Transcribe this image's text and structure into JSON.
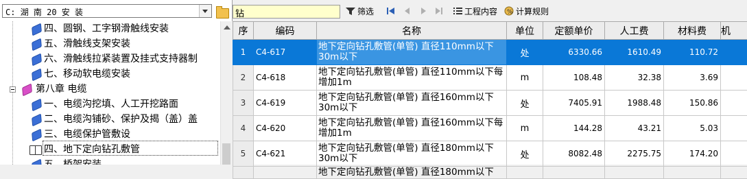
{
  "left_panel": {
    "combo_value": "C: 湖 南 20 安 装",
    "tree": [
      {
        "label": "四、圆钢、工字钢滑触线安装",
        "icon": "blue-book-icon"
      },
      {
        "label": "五、滑触线支架安装",
        "icon": "blue-book-icon"
      },
      {
        "label": "六、滑触线拉紧装置及挂式支持器制",
        "icon": "blue-book-icon"
      },
      {
        "label": "七、移动软电缆安装",
        "icon": "blue-book-icon"
      },
      {
        "label": "第八章 电缆",
        "icon": "pink-book-icon"
      },
      {
        "label": "一、电缆沟挖填、人工开挖路面",
        "icon": "blue-book-icon"
      },
      {
        "label": "二、电缆沟铺砂、保护及揭（盖）盖",
        "icon": "blue-book-icon"
      },
      {
        "label": "三、电缆保护管敷设",
        "icon": "blue-book-icon"
      },
      {
        "label": "四、地下定向钻孔敷管",
        "icon": "open-book-icon"
      },
      {
        "label": "五、桥架安装",
        "icon": "blue-book-icon"
      }
    ]
  },
  "toolbar": {
    "search_value": "钻",
    "filter_label": "筛选",
    "work_content_label": "工程内容",
    "calc_rule_label": "计算规则"
  },
  "grid": {
    "headers": [
      "序",
      "编码",
      "名称",
      "单位",
      "定额单价",
      "人工费",
      "材料费",
      "机"
    ],
    "rows": [
      {
        "n": "1",
        "code": "C4-617",
        "name": "地下定向钻孔敷管(单管) 直径110mm以下30m以下",
        "unit": "处",
        "price": "6330.66",
        "labor": "1610.49",
        "material": "110.72"
      },
      {
        "n": "2",
        "code": "C4-618",
        "name": "地下定向钻孔敷管(单管) 直径110mm以下每增加1m",
        "unit": "m",
        "price": "108.48",
        "labor": "32.38",
        "material": "3.69"
      },
      {
        "n": "3",
        "code": "C4-619",
        "name": "地下定向钻孔敷管(单管) 直径160mm以下30m以下",
        "unit": "处",
        "price": "7405.91",
        "labor": "1988.48",
        "material": "150.86"
      },
      {
        "n": "4",
        "code": "C4-620",
        "name": "地下定向钻孔敷管(单管) 直径160mm以下每增加1m",
        "unit": "m",
        "price": "144.28",
        "labor": "43.21",
        "material": "5.03"
      },
      {
        "n": "5",
        "code": "C4-621",
        "name": "地下定向钻孔敷管(单管) 直径180mm以下30m以下",
        "unit": "处",
        "price": "8082.48",
        "labor": "2275.75",
        "material": "174.20"
      },
      {
        "n": "",
        "code": "",
        "name": "地下定向钻孔敷管(单管) 直径180mm以下",
        "unit": "",
        "price": "",
        "labor": "",
        "material": ""
      }
    ]
  }
}
